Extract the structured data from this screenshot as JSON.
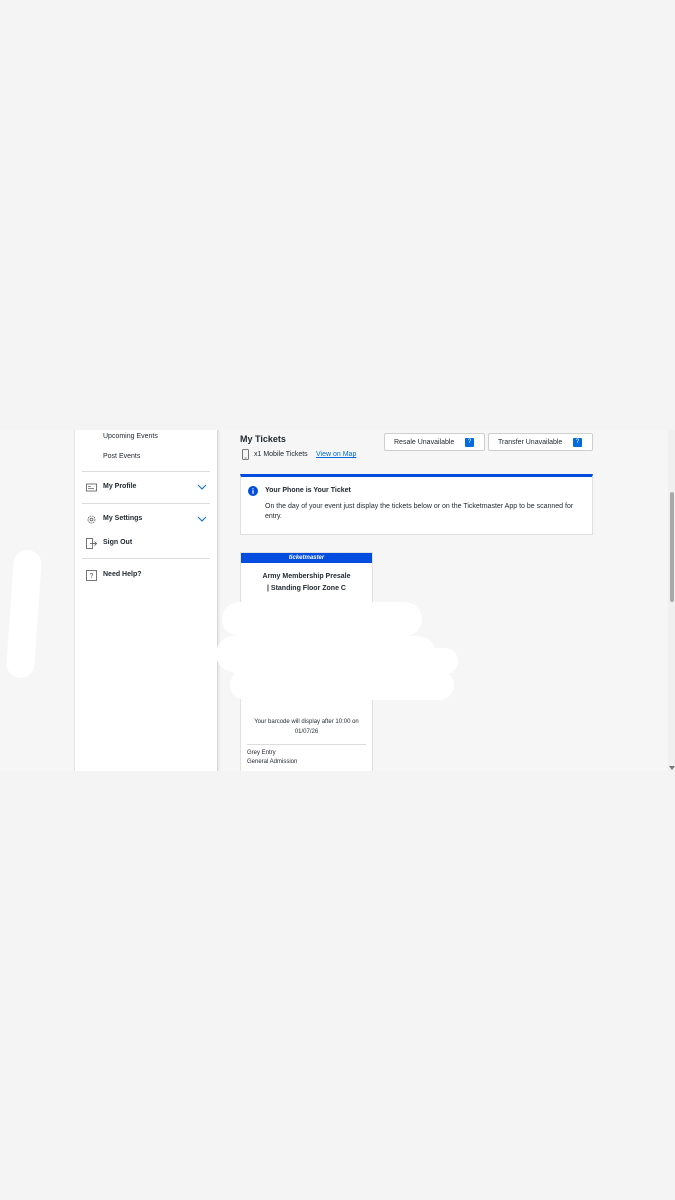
{
  "sidebar": {
    "upcoming_events": "Upcoming Events",
    "post_events": "Post Events",
    "my_profile": "My Profile",
    "my_settings": "My Settings",
    "sign_out": "Sign Out",
    "need_help": "Need Help?"
  },
  "main": {
    "title": "My Tickets",
    "mobile_count": "x1 Mobile Tickets",
    "view_map": "View on Map",
    "resale_button": "Resale Unavailable",
    "transfer_button": "Transfer Unavailable",
    "help_glyph": "?"
  },
  "notice": {
    "heading": "Your Phone is Your Ticket",
    "body": "On the day of your event just display the tickets below or on the Ticketmaster App to be scanned for entry."
  },
  "ticket": {
    "brand": "ticketmaster",
    "name_line1": "Army Membership Presale",
    "name_line2": "| Standing Floor Zone C",
    "barcode_line1": "Your barcode will display after 10:00 on",
    "barcode_line2": "01/07/26",
    "entry": "Grey Entry",
    "admission": "General Admission"
  },
  "colors": {
    "accent": "#026cdf",
    "brand_bar": "#024ddf"
  }
}
